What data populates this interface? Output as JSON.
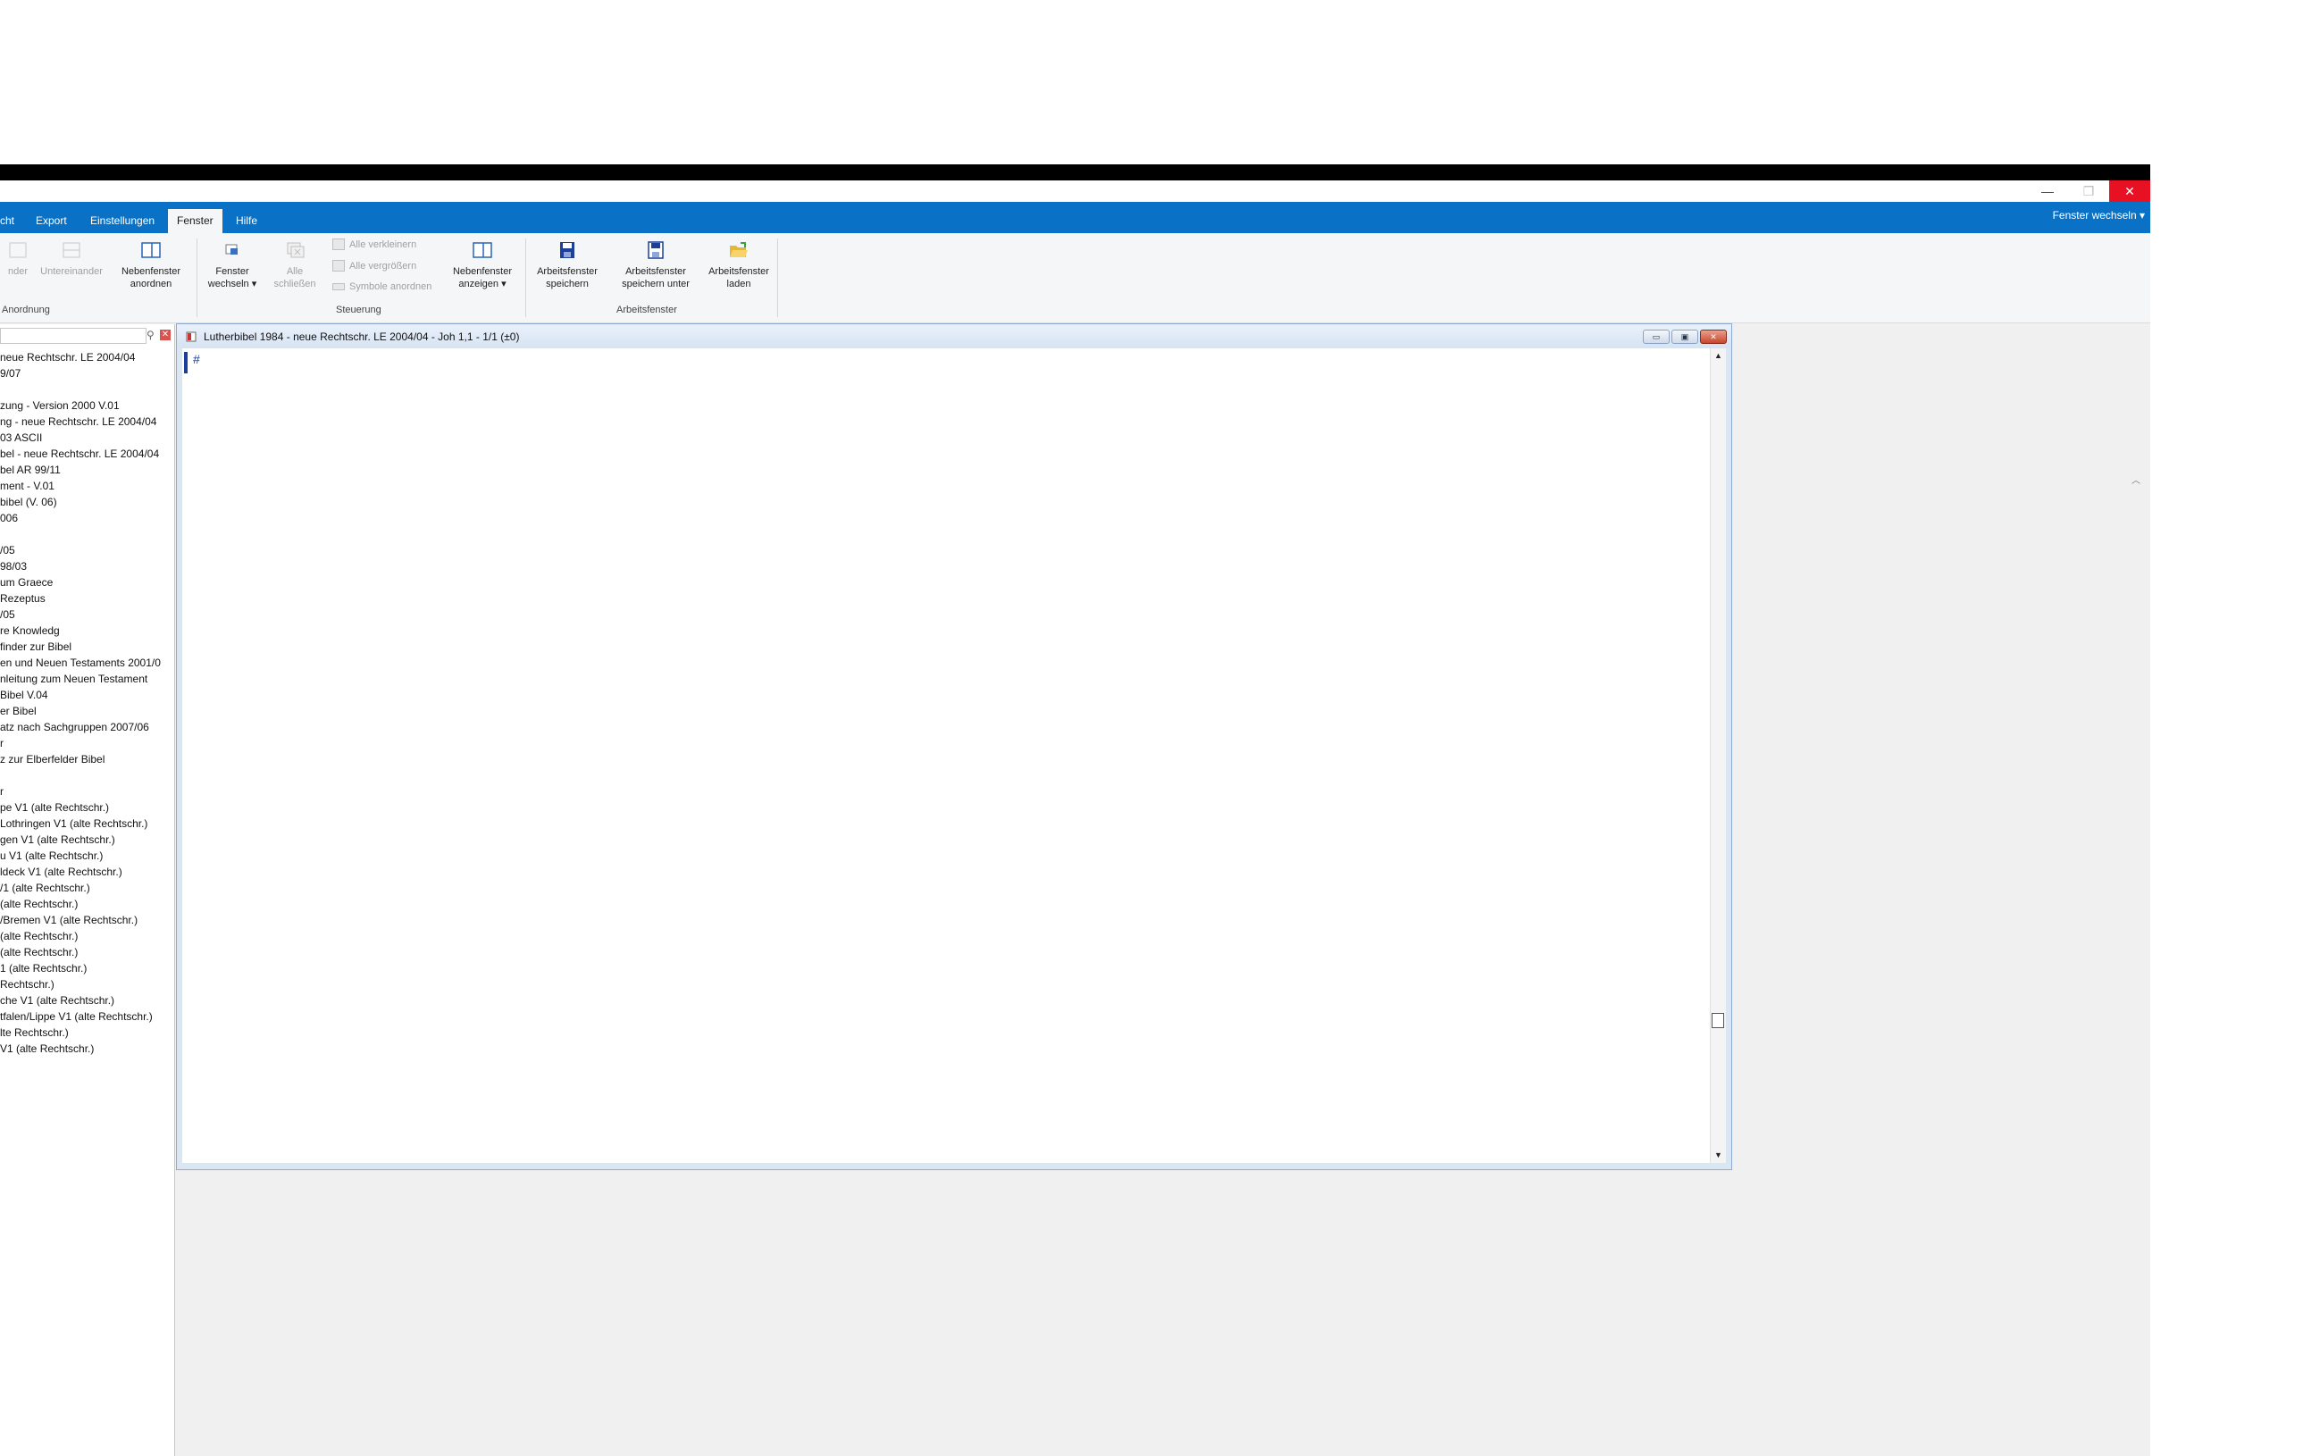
{
  "window": {
    "minimize": "—",
    "maximize": "❐",
    "close": "✕"
  },
  "tabs": [
    {
      "label": "cht",
      "active": false
    },
    {
      "label": "Export",
      "active": false
    },
    {
      "label": "Einstellungen",
      "active": false
    },
    {
      "label": "Fenster",
      "active": true
    },
    {
      "label": "Hilfe",
      "active": false
    }
  ],
  "fenster_wechseln_right": "Fenster wechseln",
  "ribbon": {
    "anordnung": {
      "label": "Anordnung",
      "nebeneinander": "nder",
      "untereinander": "Untereinander",
      "nebenfenster_anordnen": [
        "Nebenfenster",
        "anordnen"
      ]
    },
    "steuerung": {
      "label": "Steuerung",
      "fenster_wechseln": [
        "Fenster",
        "wechseln ▾"
      ],
      "alle_schliessen": [
        "Alle",
        "schließen"
      ],
      "alle_verkleinern": "Alle verkleinern",
      "alle_vergroessern": "Alle vergrößern",
      "symbole_anordnen": "Symbole anordnen",
      "nebenfenster_anzeigen": [
        "Nebenfenster",
        "anzeigen ▾"
      ]
    },
    "arbeitsfenster": {
      "label": "Arbeitsfenster",
      "speichern": [
        "Arbeitsfenster",
        "speichern"
      ],
      "speichern_unter": [
        "Arbeitsfenster",
        "speichern unter"
      ],
      "laden": [
        "Arbeitsfenster",
        "laden"
      ]
    }
  },
  "left_panel": {
    "items": [
      "neue Rechtschr. LE 2004/04",
      "9/07",
      "",
      "zung - Version 2000 V.01",
      "ng - neue Rechtschr. LE 2004/04",
      "03 ASCII",
      "bel - neue Rechtschr. LE 2004/04",
      "bel AR 99/11",
      "ment - V.01",
      "bibel (V. 06)",
      "006",
      "",
      "/05",
      "98/03",
      "um Graece",
      "Rezeptus",
      "/05",
      "re Knowledg",
      "finder zur Bibel",
      "en und Neuen Testaments 2001/0",
      "nleitung zum Neuen Testament",
      "Bibel V.04",
      "er Bibel",
      "atz nach Sachgruppen 2007/06",
      "r",
      "z zur Elberfelder Bibel",
      "",
      "r",
      "pe V1 (alte Rechtschr.)",
      "Lothringen V1 (alte Rechtschr.)",
      "gen V1 (alte Rechtschr.)",
      "u V1 (alte Rechtschr.)",
      "ldeck V1 (alte Rechtschr.)",
      "/1 (alte Rechtschr.)",
      "(alte Rechtschr.)",
      "/Bremen V1 (alte Rechtschr.)",
      "(alte Rechtschr.)",
      "(alte Rechtschr.)",
      "1 (alte Rechtschr.)",
      "Rechtschr.)",
      "che V1 (alte Rechtschr.)",
      "tfalen/Lippe V1 (alte Rechtschr.)",
      "lte Rechtschr.)",
      "V1 (alte Rechtschr.)"
    ]
  },
  "document": {
    "title": "Lutherbibel 1984 - neue Rechtschr. LE 2004/04 - Joh 1,1  -  1/1 (±0)",
    "content_marker": "#"
  },
  "colors": {
    "accent": "#0a72c6",
    "close": "#e81123"
  }
}
